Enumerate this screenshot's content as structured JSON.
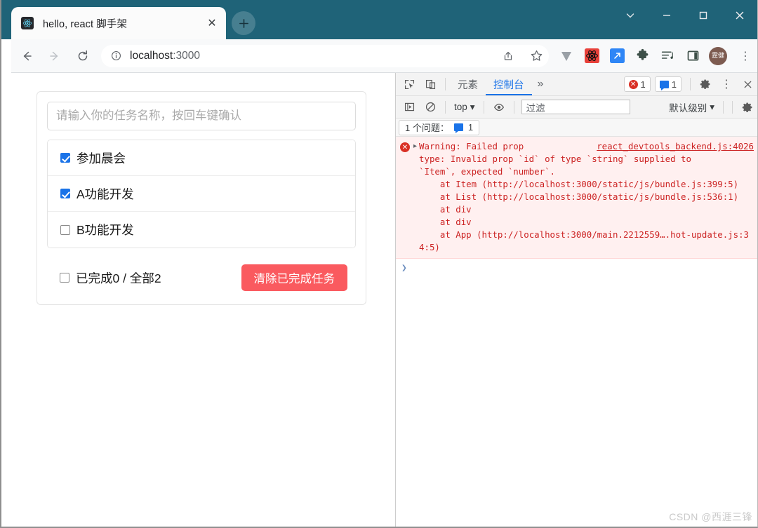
{
  "window": {
    "controls": [
      {
        "name": "chevron-down",
        "glyph": "⌄"
      },
      {
        "name": "minimize",
        "glyph": "—"
      },
      {
        "name": "maximize",
        "glyph": "□"
      },
      {
        "name": "close",
        "glyph": "✕"
      }
    ],
    "chrome_color": "#1f6378"
  },
  "tab": {
    "title": "hello, react 脚手架",
    "favicon_name": "react-logo-icon",
    "close_glyph": "✕",
    "newtab_glyph": "+"
  },
  "toolbar": {
    "back_glyph": "←",
    "forward_glyph": "→",
    "reload_glyph": "↻",
    "url_main": "localhost",
    "url_port": ":3000",
    "info_glyph": "ⓘ",
    "share_glyph": "↱",
    "star_glyph": "☆",
    "extensions": [
      {
        "name": "vimium-v-icon",
        "label": "V"
      },
      {
        "name": "react-devtools-icon",
        "label": ""
      },
      {
        "name": "screenshot-icon",
        "label": "↗"
      },
      {
        "name": "puzzle-extensions-icon",
        "label": ""
      },
      {
        "name": "playlist-icon",
        "label": ""
      },
      {
        "name": "sidepanel-icon",
        "label": ""
      }
    ],
    "avatar_label": "霆健",
    "menu_glyph": "⋮"
  },
  "page": {
    "input_placeholder": "请输入你的任务名称，按回车键确认",
    "input_value": "",
    "items": [
      {
        "label": "参加晨会",
        "done": true
      },
      {
        "label": "A功能开发",
        "done": true
      },
      {
        "label": "B功能开发",
        "done": false
      }
    ],
    "footer_text": "已完成0 / 全部2",
    "footer_checked": false,
    "clear_button": "清除已完成任务",
    "clear_button_color": "#fa5a5f",
    "checkbox_color": "#1a73e8"
  },
  "devtools": {
    "inspect_icon": "inspect-element-icon",
    "device_icon": "device-toolbar-icon",
    "tabs": [
      {
        "label": "元素",
        "active": false
      },
      {
        "label": "控制台",
        "active": true
      }
    ],
    "more_tabs_glyph": "»",
    "error_count": "1",
    "message_count": "1",
    "settings_glyph": "⚙",
    "kebab_glyph": "⋮",
    "close_glyph": "✕",
    "row2": {
      "sidebar_glyph": "▶",
      "clear_glyph": "⊘",
      "context": "top",
      "context_caret": "▾",
      "eye_glyph": "◉",
      "filter_placeholder": "过滤",
      "level": "默认级别",
      "level_caret": "▾",
      "gear_glyph": "⚙"
    },
    "issues_label": "1 个问题：",
    "issues_count": "1",
    "console": {
      "error_badge": "✕",
      "expand_arrow": "▸",
      "source_link": "react_devtools_backend.js:4026",
      "lines": [
        "Warning: Failed prop",
        "type: Invalid prop `id` of type `string` supplied to",
        "`Item`, expected `number`.",
        "    at Item (http://localhost:3000/static/js/bundle.js:399:5)",
        "    at List (http://localhost:3000/static/js/bundle.js:536:1)",
        "    at div",
        "    at div",
        "    at App (http://localhost:3000/main.2212559….hot-update.js:34:5)"
      ],
      "prompt_glyph": "❯"
    }
  },
  "watermark": "CSDN @西涯三锋"
}
